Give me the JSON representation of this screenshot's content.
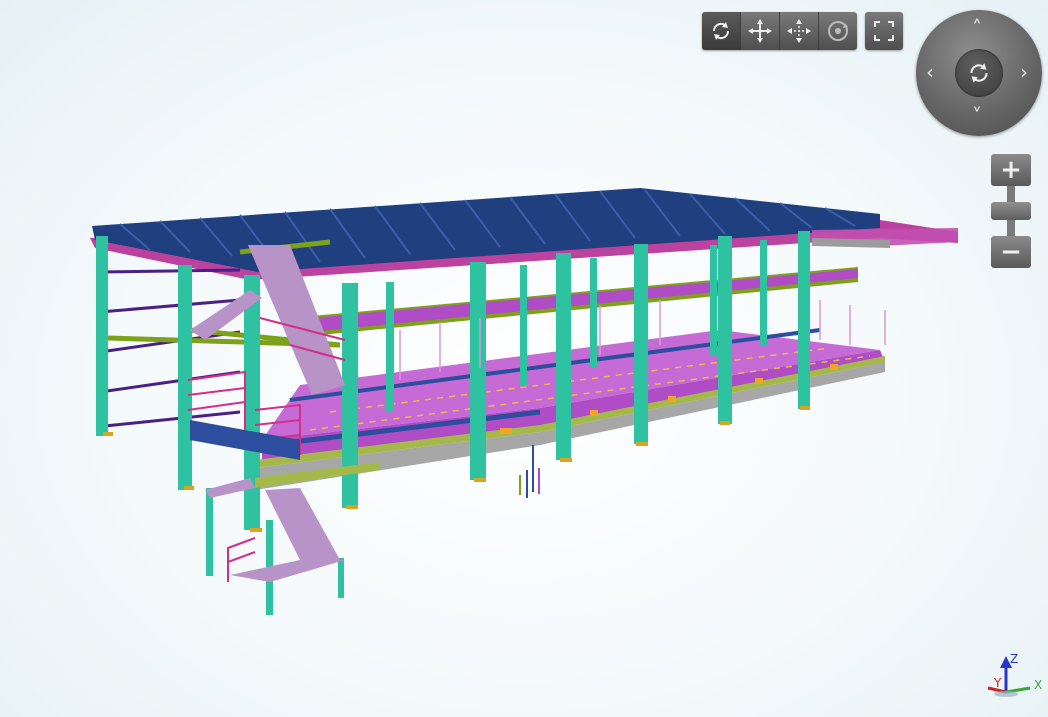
{
  "toolbar": {
    "buttons": [
      {
        "icon": "orbit-icon",
        "active": true
      },
      {
        "icon": "pan-icon"
      },
      {
        "icon": "pan-constrained-icon"
      },
      {
        "icon": "look-around-icon"
      }
    ],
    "fullscreen_icon": "fullscreen-icon"
  },
  "navigation_wheel": {
    "up": "˄",
    "down": "˅",
    "left": "‹",
    "right": "›",
    "center_icon": "orbit-icon"
  },
  "zoom": {
    "in_label": "+",
    "out_label": "−"
  },
  "axis_gizmo": {
    "z_label": "Z",
    "x_label": "X",
    "y_label": "Y"
  },
  "colors": {
    "roof_panels": "#1f3f7e",
    "roof_underside": "#b1218e",
    "columns": "#2fc2a0",
    "floor_deck": "#b04cc6",
    "beams_green": "#7ea11a",
    "edge_beams": "#a7a7a7",
    "blue_beams": "#2d4d9e",
    "railing": "#d12f8c",
    "stair_treads": "#b793c8",
    "yellow_connections": "#f0a526"
  }
}
